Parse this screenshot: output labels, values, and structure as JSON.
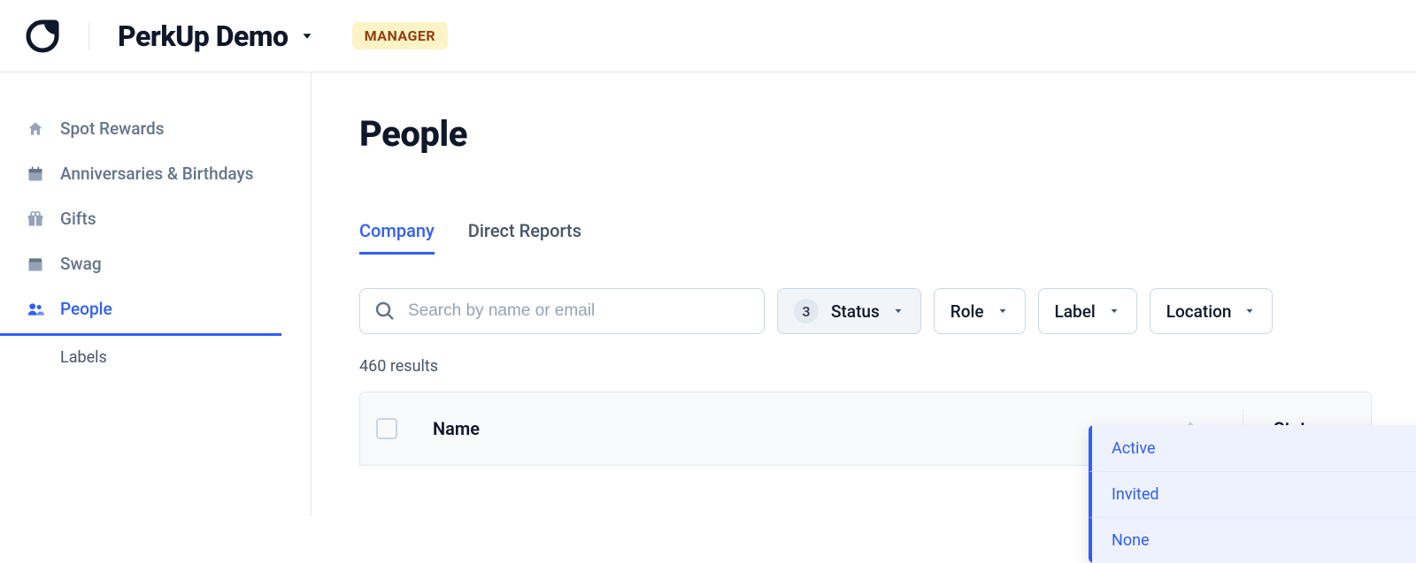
{
  "header": {
    "org_name": "PerkUp Demo",
    "role_badge": "MANAGER"
  },
  "sidebar": {
    "items": [
      {
        "label": "Spot Rewards"
      },
      {
        "label": "Anniversaries & Birthdays"
      },
      {
        "label": "Gifts"
      },
      {
        "label": "Swag"
      },
      {
        "label": "People"
      }
    ],
    "sub": {
      "label": "Labels"
    }
  },
  "main": {
    "page_title": "People",
    "tabs": [
      {
        "label": "Company"
      },
      {
        "label": "Direct Reports"
      }
    ],
    "search": {
      "placeholder": "Search by name or email"
    },
    "filters": {
      "status": {
        "label": "Status",
        "count": "3"
      },
      "role": {
        "label": "Role"
      },
      "label": {
        "label": "Label"
      },
      "location": {
        "label": "Location"
      }
    },
    "results_text": "460 results",
    "columns": {
      "name": "Name",
      "status": "Status"
    },
    "status_dropdown": [
      "Active",
      "Invited",
      "None"
    ]
  }
}
